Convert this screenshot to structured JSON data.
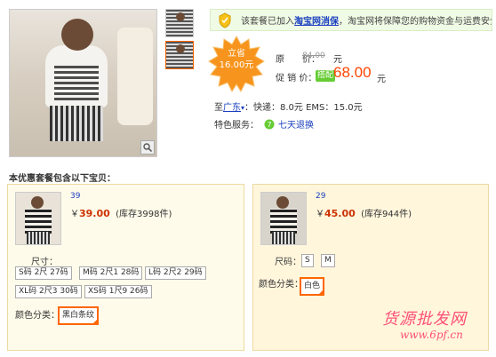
{
  "notice": {
    "text_before": "该套餐已加入",
    "link": "淘宝网消保",
    "text_after": "，淘宝网将保障您的购物资金与运费安全。"
  },
  "badge": {
    "line1": "立省",
    "line2": "16.00元"
  },
  "price": {
    "orig_label": "原　　价：",
    "orig_value": "84.00",
    "orig_unit": "元",
    "promo_label": "促 销 价：",
    "promo_tag": "搭配",
    "promo_value": "68.00",
    "promo_unit": "元"
  },
  "shipping": {
    "prefix": "至",
    "city": "广东",
    "arrow": "▾",
    "rest": "：快递：8.0元  EMS：15.0元"
  },
  "service": {
    "label": "特色服务：",
    "link": "七天退换"
  },
  "section_title": "本优惠套餐包含以下宝贝：",
  "left_item": {
    "id": "39",
    "currency": "￥",
    "price": "39.00",
    "stock": "(库存3998件)",
    "size_label": "尺寸：",
    "sizes": [
      "S码 2尺 27码",
      "M码 2尺1 28码",
      "L码 2尺2 29码",
      "XL码 2尺3 30码",
      "XS码 1尺9 26码"
    ],
    "color_label": "颜色分类：",
    "color": "黑白条纹"
  },
  "right_item": {
    "id": "29",
    "currency": "￥",
    "price": "45.00",
    "stock": "(库存944件)",
    "size_label": "尺码：",
    "sizes": [
      "S",
      "M"
    ],
    "color_label": "颜色分类：",
    "color": "白色"
  },
  "watermark": {
    "line1": "货源批发网",
    "line2": "www.6pf.cn"
  },
  "colors": {
    "accent": "#ff6600",
    "price": "#ff4400",
    "link": "#1a3fbf",
    "notice_bg": "#f0fbe6"
  }
}
